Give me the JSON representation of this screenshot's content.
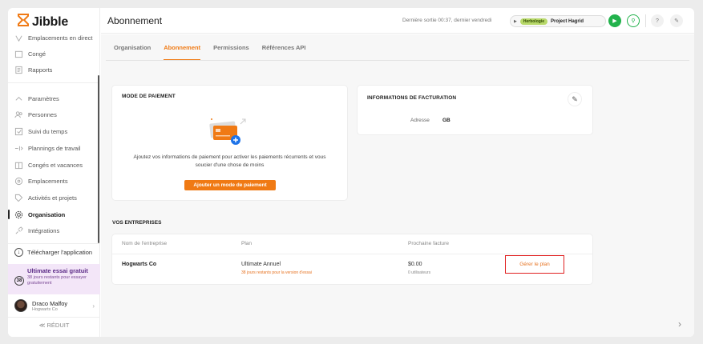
{
  "app": {
    "logo_text": "Jibble"
  },
  "sidebar": {
    "items": [
      {
        "label": "Emplacements en direct",
        "icon": "location-icon"
      },
      {
        "label": "Congé",
        "icon": "calendar-icon"
      },
      {
        "label": "Rapports",
        "icon": "report-icon"
      },
      {
        "label": "Paramètres",
        "icon": "settings-chevron-icon"
      },
      {
        "label": "Personnes",
        "icon": "people-icon"
      },
      {
        "label": "Suivi du temps",
        "icon": "time-tracking-icon"
      },
      {
        "label": "Plannings de travail",
        "icon": "schedule-icon"
      },
      {
        "label": "Congés et vacances",
        "icon": "leave-icon"
      },
      {
        "label": "Emplacements",
        "icon": "pin-icon"
      },
      {
        "label": "Activités et projets",
        "icon": "tag-icon"
      },
      {
        "label": "Organisation",
        "icon": "gear-icon"
      },
      {
        "label": "Intégrations",
        "icon": "plug-icon"
      }
    ],
    "download_label": "Télécharger l'application",
    "trial": {
      "title": "Ultimate essai gratuit",
      "days": "38",
      "subtitle": "38 jours restants pour essayer gratuitement"
    },
    "user": {
      "name": "Draco Malfoy",
      "org": "Hogwarts Co"
    },
    "reduce_label": "≪  RÉDUIT"
  },
  "topbar": {
    "title": "Abonnement",
    "last_out": "Dernière sortie 00:37, dernier vendredi",
    "tracker_tag": "Herbologie",
    "tracker_project": "Project Hagrid"
  },
  "tabs": [
    {
      "label": "Organisation"
    },
    {
      "label": "Abonnement"
    },
    {
      "label": "Permissions"
    },
    {
      "label": "Références API"
    }
  ],
  "payment": {
    "title": "MODE DE PAIEMENT",
    "text": "Ajoutez vos informations de paiement pour activer les paiements récurrents et vous soucier d'une chose de moins",
    "button": "Ajouter un mode de paiement"
  },
  "billing": {
    "title": "INFORMATIONS DE FACTURATION",
    "address_label": "Adresse",
    "address_value": "GB"
  },
  "companies": {
    "title": "VOS ENTREPRISES",
    "headers": {
      "name": "Nom de l'entreprise",
      "plan": "Plan",
      "invoice": "Prochaine facture"
    },
    "row": {
      "name": "Hogwarts Co",
      "plan": "Ultimate Annuel",
      "plan_sub": "38 jours restants pour la version d'essai",
      "amount": "$0.00",
      "users": "0 utilisateurs",
      "manage": "Gérer le plan"
    }
  },
  "colors": {
    "accent": "#f07a14",
    "green": "#22b24c",
    "highlight": "#e02020"
  }
}
